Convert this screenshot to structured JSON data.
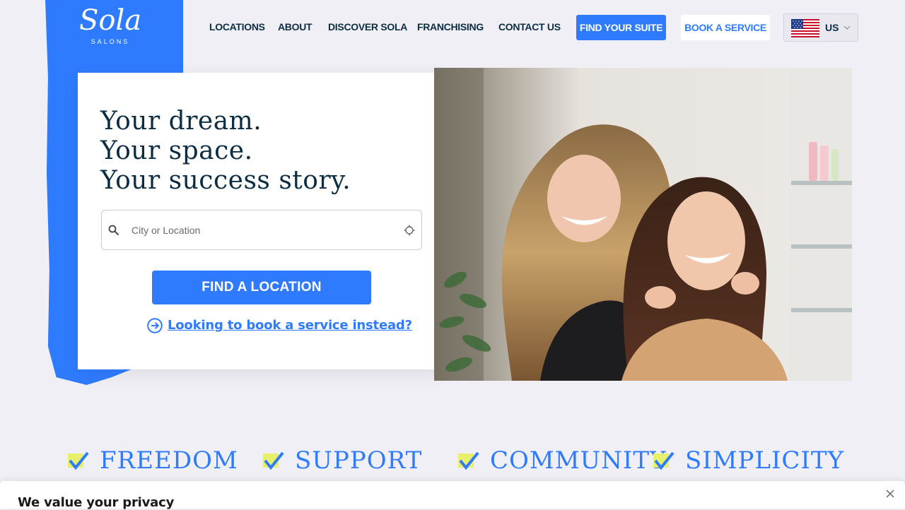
{
  "brand": {
    "name": "Sola",
    "subtitle": "SALONS",
    "color": "#2f7bff",
    "dark": "#0d2d44"
  },
  "nav": {
    "items": [
      "LOCATIONS",
      "ABOUT",
      "DISCOVER SOLA",
      "FRANCHISING",
      "CONTACT US"
    ],
    "find_suite": "FIND YOUR SUITE",
    "book_service": "BOOK A SERVICE",
    "country": {
      "code": "US",
      "flag": "us-flag-icon"
    }
  },
  "hero": {
    "headline": [
      "Your dream.",
      "Your space.",
      "Your success story."
    ],
    "search": {
      "placeholder": "City or Location",
      "value": ""
    },
    "find_button": "FIND A LOCATION",
    "book_link": "Looking to book a service instead?",
    "image": "two-women-smiling-in-salon"
  },
  "values": [
    "FREEDOM",
    "SUPPORT",
    "COMMUNITY",
    "SIMPLICITY"
  ],
  "privacy": {
    "title": "We value your privacy"
  }
}
